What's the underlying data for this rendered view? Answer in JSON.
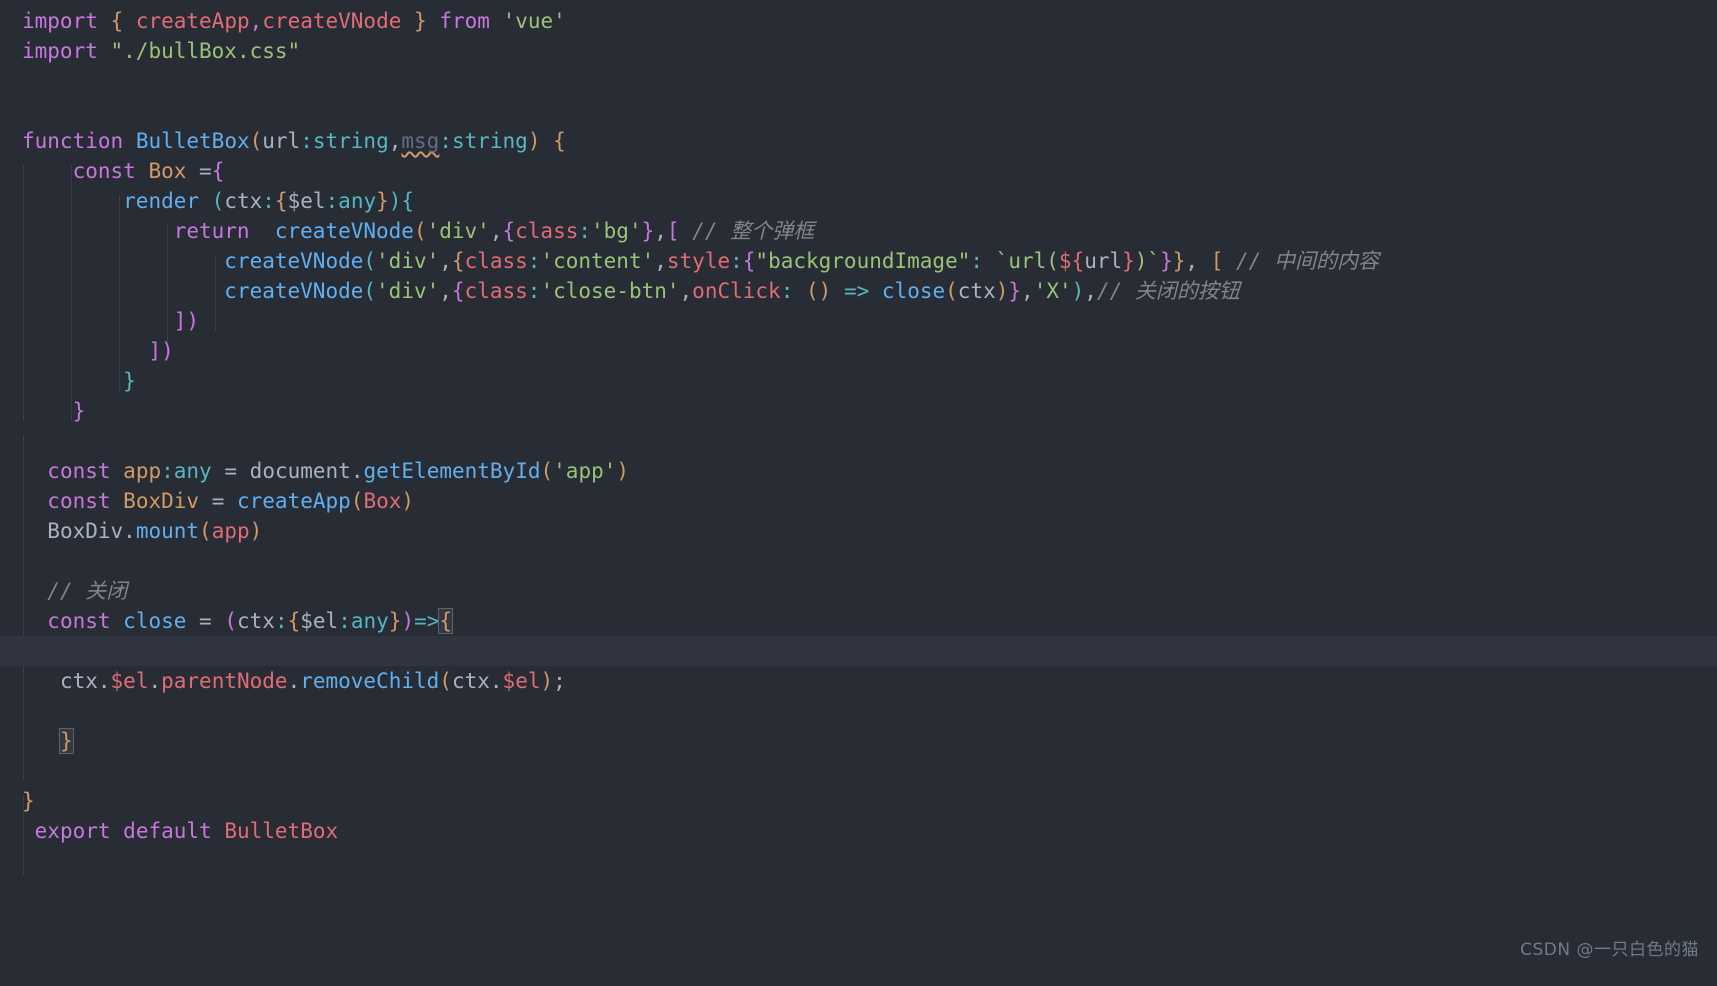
{
  "editor": {
    "background": "#282c34",
    "default_text_color": "#abb2bf",
    "font_size_px": 21,
    "line_height_px": 30,
    "language": "typescript",
    "filename_hint": "bullBox.ts",
    "highlighted_line_index": 21
  },
  "colors": {
    "keyword": "#c678dd",
    "function": "#61afef",
    "type": "#56b6c2",
    "string": "#98c379",
    "property": "#e06c75",
    "orange": "#d19a66",
    "comment": "#7f848e",
    "plain": "#abb2bf",
    "indent_guide": "#3b4048",
    "current_line_bg": "#2f3440"
  },
  "code": {
    "lines": [
      "import { createApp,createVNode } from 'vue'",
      "import \"./bullBox.css\"",
      "",
      "",
      "function BulletBox(url:string,msg:string) {",
      "    const Box ={",
      "        render (ctx:{$el:any}){",
      "            return  createVNode('div',{class:'bg'},[ // 整个弹框",
      "                createVNode('div',{class:'content',style:{\"backgroundImage\": `url(${url})`}}, [ // 中间的内容",
      "                createVNode('div',{class:'close-btn',onClick: () => close(ctx)},'X'),// 关闭的按钮",
      "            ])",
      "          ])",
      "        }",
      "    }",
      "",
      "  const app:any = document.getElementById('app')",
      "  const BoxDiv = createApp(Box)",
      "  BoxDiv.mount(app)",
      "",
      "  // 关闭",
      "  const close = (ctx:{$el:any})=>{",
      "",
      "   ctx.$el.parentNode.removeChild(ctx.$el);",
      "",
      "   }",
      "",
      "}",
      " export default BulletBox"
    ],
    "comments": {
      "whole_dialog": "// 整个弹框",
      "middle_content": "// 中间的内容",
      "close_button": "// 关闭的按钮",
      "close": "// 关闭"
    },
    "identifiers": {
      "module": "vue",
      "css_import": "./bullBox.css",
      "component_function": "BulletBox",
      "object_name": "Box",
      "render_method": "render",
      "vnode_factory": "createVNode",
      "app_factory": "createApp",
      "mount_target_id": "app",
      "close_handler": "close",
      "close_label": "X",
      "classes": [
        "bg",
        "content",
        "close-btn"
      ],
      "style_prop": "backgroundImage",
      "params": [
        "url",
        "msg",
        "ctx"
      ],
      "types": [
        "string",
        "any"
      ],
      "unused_param_warning": "msg"
    }
  },
  "watermark": {
    "text": "CSDN @一只白色的猫"
  }
}
